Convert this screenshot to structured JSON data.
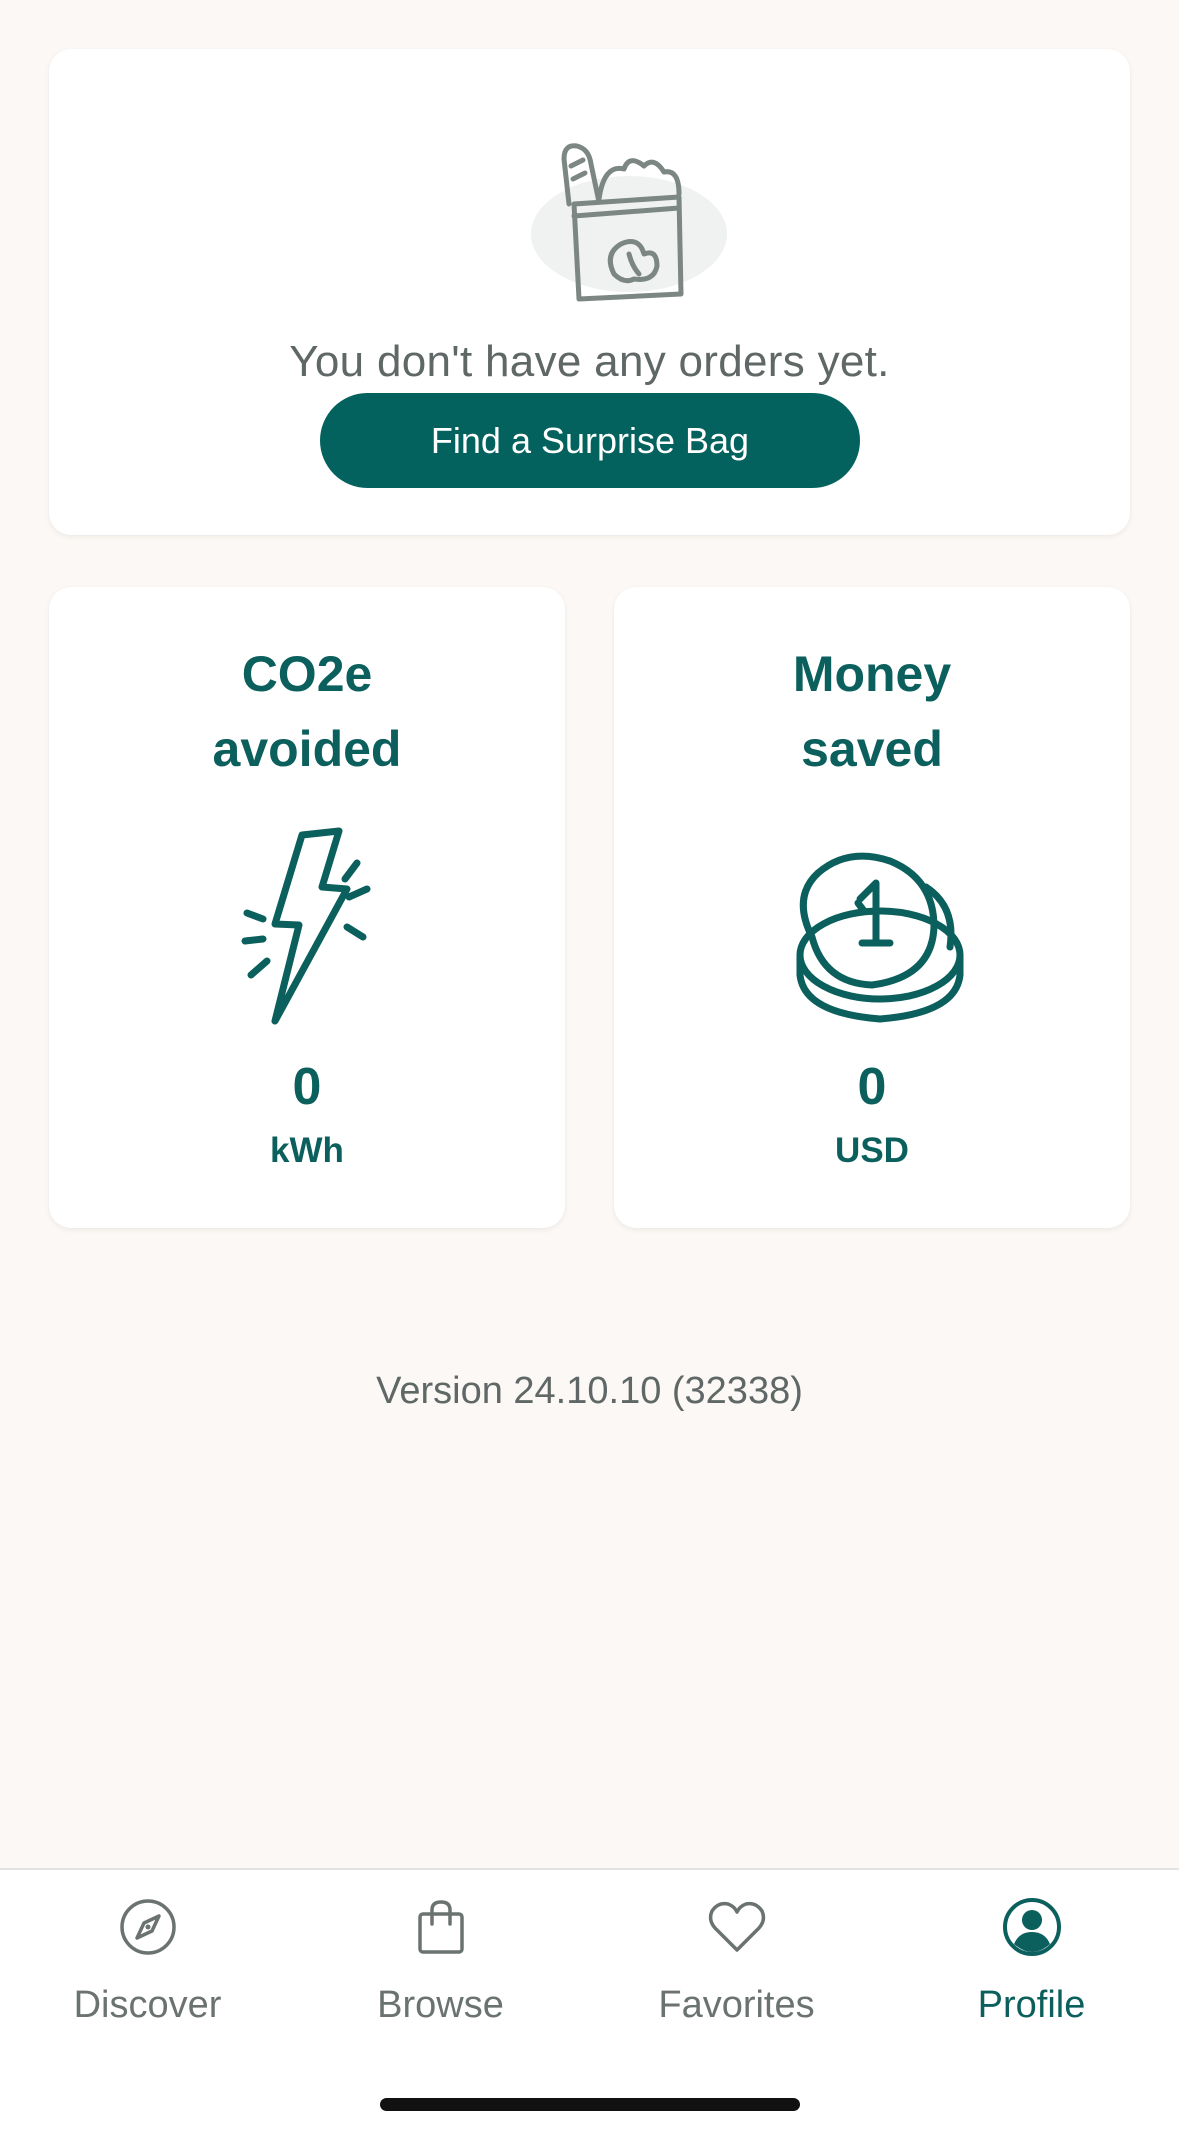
{
  "orders": {
    "empty_text": "You don't have any orders yet.",
    "cta_label": "Find a Surprise Bag",
    "illustration": "grocery-bag-icon"
  },
  "stats": {
    "co2": {
      "title_line1": "CO2e",
      "title_line2": "avoided",
      "value": "0",
      "unit": "kWh",
      "icon": "lightning-icon"
    },
    "money": {
      "title_line1": "Money",
      "title_line2": "saved",
      "value": "0",
      "unit": "USD",
      "icon": "coins-icon"
    }
  },
  "version": "Version 24.10.10 (32338)",
  "nav": {
    "items": [
      {
        "label": "Discover",
        "icon": "compass-icon",
        "active": false
      },
      {
        "label": "Browse",
        "icon": "shopping-bag-icon",
        "active": false
      },
      {
        "label": "Favorites",
        "icon": "heart-icon",
        "active": false
      },
      {
        "label": "Profile",
        "icon": "profile-icon",
        "active": true
      }
    ]
  },
  "colors": {
    "brand": "#03625e",
    "text_brand": "#0b5f5c",
    "muted_text": "#5f6866",
    "background": "#fcf8f5"
  }
}
